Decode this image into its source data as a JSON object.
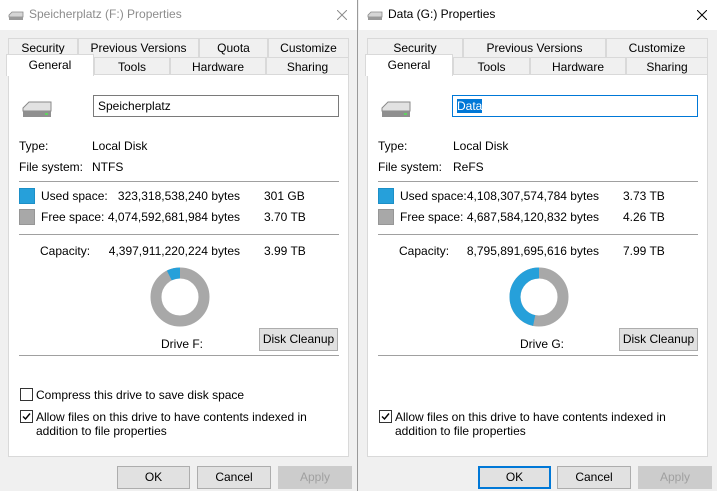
{
  "windows": [
    {
      "title": "Speicherplatz (F:) Properties",
      "tabs_row1": [
        "Security",
        "Previous Versions",
        "Quota",
        "Customize"
      ],
      "tabs_row2": [
        "General",
        "Tools",
        "Hardware",
        "Sharing"
      ],
      "selected_tab": "General",
      "name_value": "Speicherplatz",
      "type_label": "Type:",
      "type_value": "Local Disk",
      "fs_label": "File system:",
      "fs_value": "NTFS",
      "used_label": "Used space:",
      "used_bytes": "323,318,538,240 bytes",
      "used_human": "301 GB",
      "free_label": "Free space:",
      "free_bytes": "4,074,592,681,984 bytes",
      "free_human": "3.70 TB",
      "capacity_label": "Capacity:",
      "capacity_bytes": "4,397,911,220,224 bytes",
      "capacity_human": "3.99 TB",
      "used_fraction": 0.0735,
      "drive_label": "Drive F:",
      "disk_cleanup": "Disk Cleanup",
      "compress_label": "Compress this drive to save disk space",
      "compress_checked": false,
      "index_label": "Allow files on this drive to have contents indexed in addition to file properties",
      "index_checked": true,
      "ok": "OK",
      "cancel": "Cancel",
      "apply": "Apply"
    },
    {
      "title": "Data (G:) Properties",
      "tabs_row1": [
        "Security",
        "Previous Versions",
        "Customize"
      ],
      "tabs_row2": [
        "General",
        "Tools",
        "Hardware",
        "Sharing"
      ],
      "selected_tab": "General",
      "name_value": "Data",
      "type_label": "Type:",
      "type_value": "Local Disk",
      "fs_label": "File system:",
      "fs_value": "ReFS",
      "used_label": "Used space:",
      "used_bytes": "4,108,307,574,784 bytes",
      "used_human": "3.73 TB",
      "free_label": "Free space:",
      "free_bytes": "4,687,584,120,832 bytes",
      "free_human": "4.26 TB",
      "capacity_label": "Capacity:",
      "capacity_bytes": "8,795,891,695,616 bytes",
      "capacity_human": "7.99 TB",
      "used_fraction": 0.467,
      "drive_label": "Drive G:",
      "disk_cleanup": "Disk Cleanup",
      "index_label": "Allow files on this drive to have contents indexed in addition to file properties",
      "index_checked": true,
      "ok": "OK",
      "cancel": "Cancel",
      "apply": "Apply"
    }
  ],
  "colors": {
    "used": "#26a0da",
    "free": "#a8a8a8",
    "accent": "#0078d7"
  }
}
